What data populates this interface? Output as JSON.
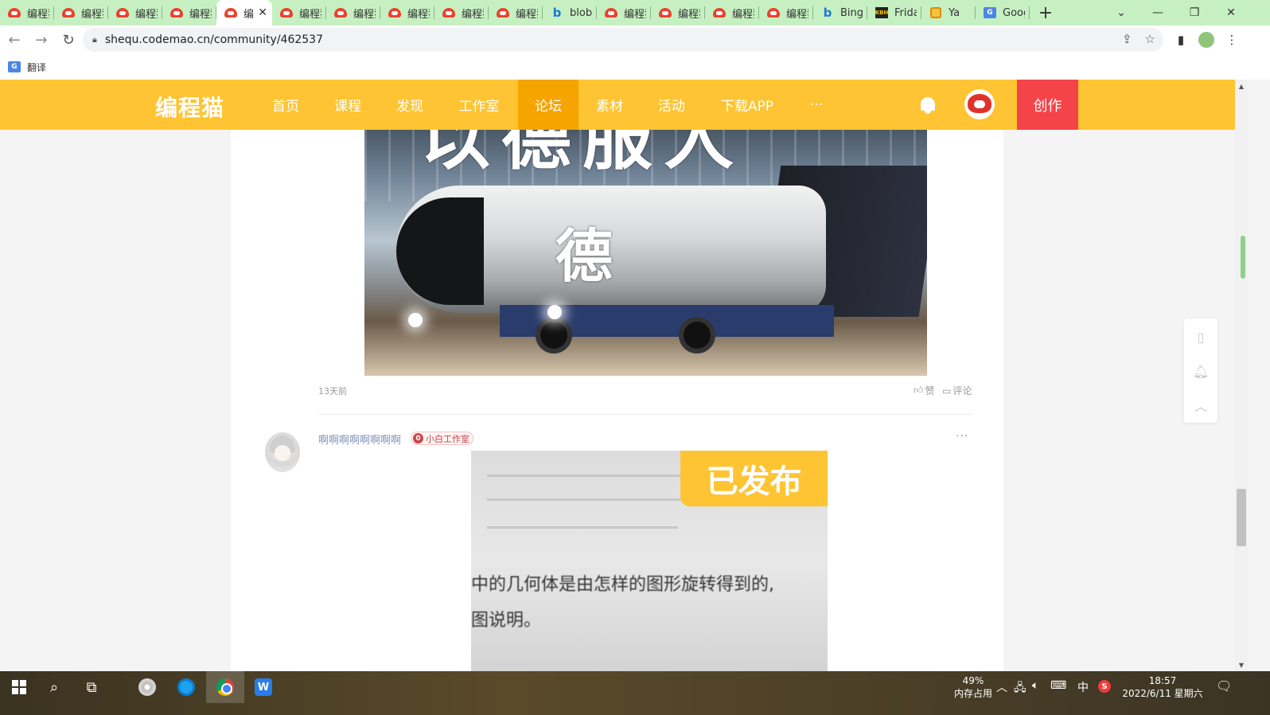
{
  "browser": {
    "tabs": [
      {
        "label": "编程猫",
        "icon": "codemao-icon"
      },
      {
        "label": "编程猫",
        "icon": "codemao-icon"
      },
      {
        "label": "编程猫",
        "icon": "codemao-icon"
      },
      {
        "label": "编程猫",
        "icon": "codemao-icon"
      },
      {
        "label": "编",
        "icon": "codemao-icon",
        "active": true
      },
      {
        "label": "编程猫",
        "icon": "codemao-icon"
      },
      {
        "label": "编程猫",
        "icon": "codemao-icon"
      },
      {
        "label": "编程猫",
        "icon": "codemao-icon"
      },
      {
        "label": "编程猫",
        "icon": "codemao-icon"
      },
      {
        "label": "编程猫",
        "icon": "codemao-icon"
      },
      {
        "label": "blob",
        "icon": "bing-icon"
      },
      {
        "label": "编程猫",
        "icon": "codemao-icon"
      },
      {
        "label": "编程猫",
        "icon": "codemao-icon"
      },
      {
        "label": "编程猫",
        "icon": "codemao-icon"
      },
      {
        "label": "编程猫",
        "icon": "codemao-icon"
      },
      {
        "label": "Bing",
        "icon": "bing-icon"
      },
      {
        "label": "Frida",
        "icon": "kbh-icon"
      },
      {
        "label": "Ya",
        "icon": "ya-icon"
      },
      {
        "label": "Goog",
        "icon": "google-translate-icon"
      }
    ],
    "url": "shequ.codemao.cn/community/462537",
    "bookmark_translate": "翻译"
  },
  "site": {
    "logo": "编程猫",
    "nav": [
      "首页",
      "课程",
      "发现",
      "工作室",
      "论坛",
      "素材",
      "活动",
      "下载APP",
      "···"
    ],
    "active_nav": "论坛",
    "create_label": "创作"
  },
  "post1": {
    "image_big_char": "德",
    "image_top_text": "以德服人",
    "time": "13天前",
    "like_label": "赞",
    "comment_label": "评论"
  },
  "reply": {
    "username": "啊啊啊啊啊啊啊啊",
    "studio_level": "0",
    "studio_name": "小白工作室",
    "more": "···",
    "image_badge": "已发布",
    "image_text_line1": "中的几何体是由怎样的图形旋转得到的,",
    "image_text_line2": "图说明。"
  },
  "taskbar": {
    "memory_percent": "49%",
    "memory_label": "内存占用",
    "ime": "中",
    "time": "18:57",
    "date": "2022/6/11 星期六"
  },
  "colors": {
    "site_header": "#fec433",
    "active_nav": "#f5a400",
    "create_button": "#f5434a",
    "tab_strip": "#c6f0c2"
  }
}
